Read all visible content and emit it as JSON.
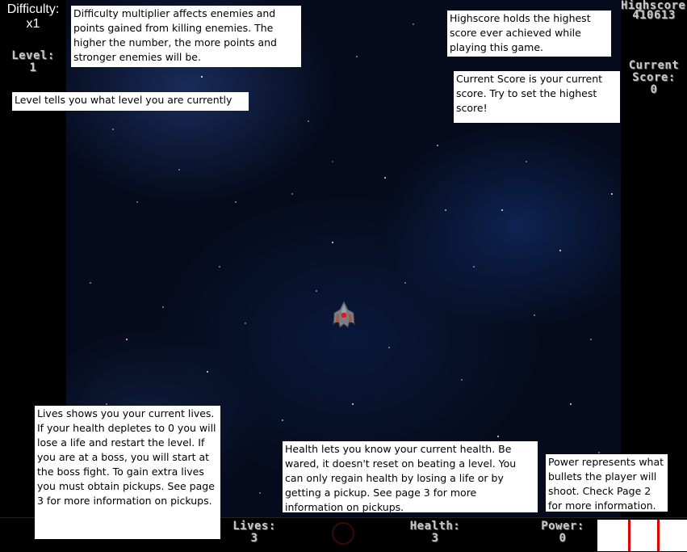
{
  "hud": {
    "difficulty_label": "Difficulty:",
    "difficulty_value": "x1",
    "level_label": "Level:",
    "level_value": "1",
    "highscore_label": "Highscore:",
    "highscore_value": "410613",
    "current_label_1": "Current",
    "current_label_2": "Score:",
    "current_value": "0",
    "lives_label": "Lives:",
    "lives_value": "3",
    "health_label": "Health:",
    "health_value": "3",
    "power_label": "Power:",
    "power_value": "0"
  },
  "notes": {
    "difficulty": "Difficulty multiplier affects enemies and points gained from killing enemies. The higher the number, the more points and stronger enemies will be.",
    "level": "Level tells you what level you are currently on.",
    "highscore": "Highscore holds the highest score ever achieved while playing this game.",
    "current_score": "Current Score is your current score. Try to set the highest score!",
    "lives": "Lives shows you your current lives. If your health depletes to 0 you will lose a life and restart the level. If you are at a boss, you will start at the boss fight. To gain extra lives you must obtain pickups. See page 3 for more information on pickups.",
    "health": "Health lets you know your current health. Be wared, it doesn't reset on beating a level. You can only regain health by losing a life or by getting a pickup. See page 3 for more information on pickups.",
    "power": "Power represents what bullets the player will shoot. Check Page 2 for more information."
  },
  "icons": {
    "player_ship": "player-ship-icon",
    "power_ring": "power-ring-icon"
  },
  "colors": {
    "meter_red": "#e00000",
    "background_space": "#050b1c"
  }
}
